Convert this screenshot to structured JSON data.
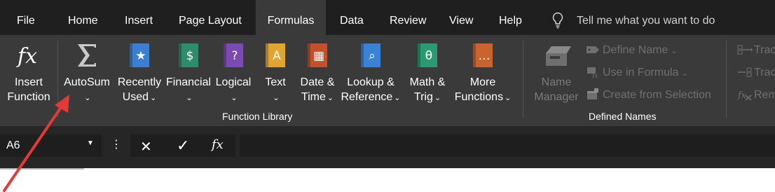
{
  "tabs": [
    "File",
    "Home",
    "Insert",
    "Page Layout",
    "Formulas",
    "Data",
    "Review",
    "View",
    "Help"
  ],
  "active_tab": "Formulas",
  "tell_me": {
    "text": "Tell me what you want to do",
    "icon": "lightbulb-icon"
  },
  "ribbon": {
    "insert_function": {
      "line1": "Insert",
      "line2": "Function",
      "icon": "fx-icon"
    },
    "function_library": {
      "label": "Function Library",
      "buttons": [
        {
          "line1": "AutoSum",
          "line2": "",
          "icon": "sigma-icon",
          "color": "#c8c8c8"
        },
        {
          "line1": "Recently",
          "line2": "Used",
          "icon": "star-book-icon",
          "color": "#3b7fd1"
        },
        {
          "line1": "Financial",
          "line2": "",
          "icon": "money-book-icon",
          "color": "#2e8b6b"
        },
        {
          "line1": "Logical",
          "line2": "",
          "icon": "question-book-icon",
          "color": "#7b4ab2"
        },
        {
          "line1": "Text",
          "line2": "",
          "icon": "letter-a-book-icon",
          "color": "#e2a431"
        },
        {
          "line1": "Date &",
          "line2": "Time",
          "icon": "calendar-book-icon",
          "color": "#c2502b"
        },
        {
          "line1": "Lookup &",
          "line2": "Reference",
          "icon": "magnifier-book-icon",
          "color": "#3b82d6"
        },
        {
          "line1": "Math &",
          "line2": "Trig",
          "icon": "theta-book-icon",
          "color": "#2a9a73"
        },
        {
          "line1": "More",
          "line2": "Functions",
          "icon": "ellipsis-book-icon",
          "color": "#c9642e"
        }
      ]
    },
    "defined_names": {
      "label": "Defined Names",
      "name_manager": {
        "line1": "Name",
        "line2": "Manager",
        "icon": "name-manager-icon"
      },
      "define_name": "Define Name",
      "use_in_formula": "Use in Formula",
      "create_from_selection": "Create from Selection"
    },
    "formula_auditing": {
      "trace_precedents": "Trac",
      "trace_dependents": "Trac",
      "remove_arrows": "Rem"
    }
  },
  "formula_bar": {
    "name_box": "A6",
    "cancel": "✕",
    "enter": "✓",
    "insert_function": "fx",
    "value": ""
  },
  "annotation": {
    "color": "#e53935"
  }
}
